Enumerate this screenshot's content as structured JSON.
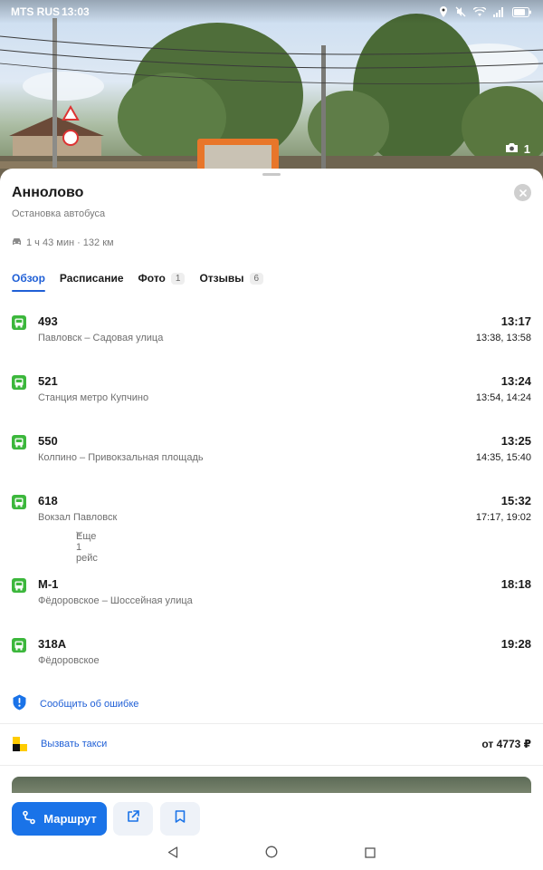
{
  "status_bar": {
    "carrier": "MTS RUS",
    "time": "13:03"
  },
  "hero": {
    "photo_count": "1"
  },
  "stop": {
    "name": "Аннолово",
    "type": "Остановка автобуса",
    "travel": "1 ч 43 мин · 132 км"
  },
  "tabs": [
    {
      "label": "Обзор",
      "badge": ""
    },
    {
      "label": "Расписание",
      "badge": ""
    },
    {
      "label": "Фото",
      "badge": "1"
    },
    {
      "label": "Отзывы",
      "badge": "6"
    }
  ],
  "routes": [
    {
      "number": "493",
      "destination": "Павловск – Садовая улица",
      "time": "13:17",
      "next": "13:38, 13:58"
    },
    {
      "number": "521",
      "destination": "Станция метро Купчино",
      "time": "13:24",
      "next": "13:54, 14:24"
    },
    {
      "number": "550",
      "destination": "Колпино – Привокзальная площадь",
      "time": "13:25",
      "next": "14:35, 15:40"
    },
    {
      "number": "618",
      "destination": "Вокзал Павловск",
      "time": "15:32",
      "next": "17:17, 19:02",
      "more": "Еще 1 рейс"
    },
    {
      "number": "М-1",
      "destination": "Фёдоровское – Шоссейная улица",
      "time": "18:18",
      "next": ""
    },
    {
      "number": "318А",
      "destination": "Фёдоровское",
      "time": "19:28",
      "next": ""
    }
  ],
  "report_label": "Сообщить об ошибке",
  "taxi": {
    "label": "Вызвать такси",
    "price": "от 4773 ₽"
  },
  "actions": {
    "route_label": "Маршрут"
  },
  "colors": {
    "accent": "#1a73e8",
    "bus_green": "#3cb73c"
  }
}
